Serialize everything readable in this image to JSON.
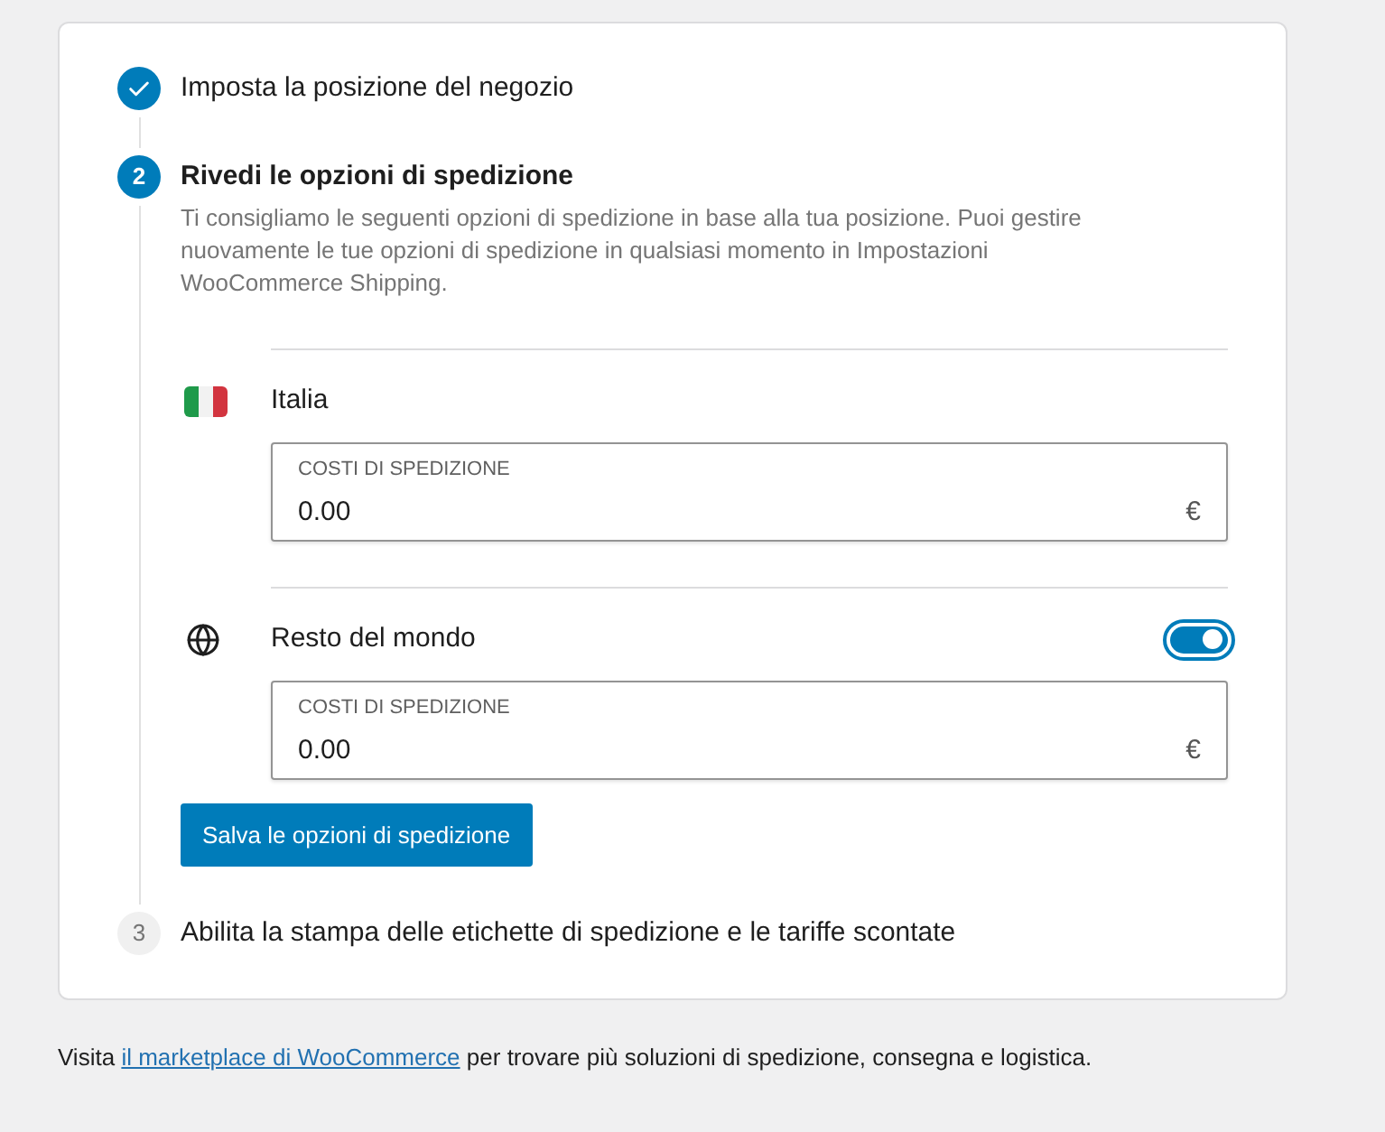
{
  "steps": [
    {
      "done": true,
      "current": false,
      "title": "Imposta la posizione del negozio"
    },
    {
      "done": false,
      "current": true,
      "number": "2",
      "title": "Rivedi le opzioni di spedizione",
      "description": "Ti consigliamo le seguenti opzioni di spedizione in base alla tua posizione. Puoi gestire nuovamente le tue opzioni di spedizione in qualsiasi momento in Impostazioni WooCommerce Shipping.",
      "zones": [
        {
          "kind": "flag",
          "name": "Italia",
          "field": {
            "label": "COSTI DI SPEDIZIONE",
            "value": "0.00",
            "suffix": "€"
          }
        },
        {
          "kind": "globe",
          "name": "Resto del mondo",
          "toggle": {
            "on": true
          },
          "field": {
            "label": "COSTI DI SPEDIZIONE",
            "value": "0.00",
            "suffix": "€"
          }
        }
      ],
      "button": "Salva le opzioni di spedizione"
    },
    {
      "done": false,
      "current": false,
      "number": "3",
      "title": "Abilita la stampa delle etichette di spedizione e le tariffe scontate"
    }
  ],
  "footer": {
    "before": "Visita",
    "link": "il marketplace di WooCommerce",
    "after": "per trovare più soluzioni di spedizione, consegna e logistica."
  }
}
